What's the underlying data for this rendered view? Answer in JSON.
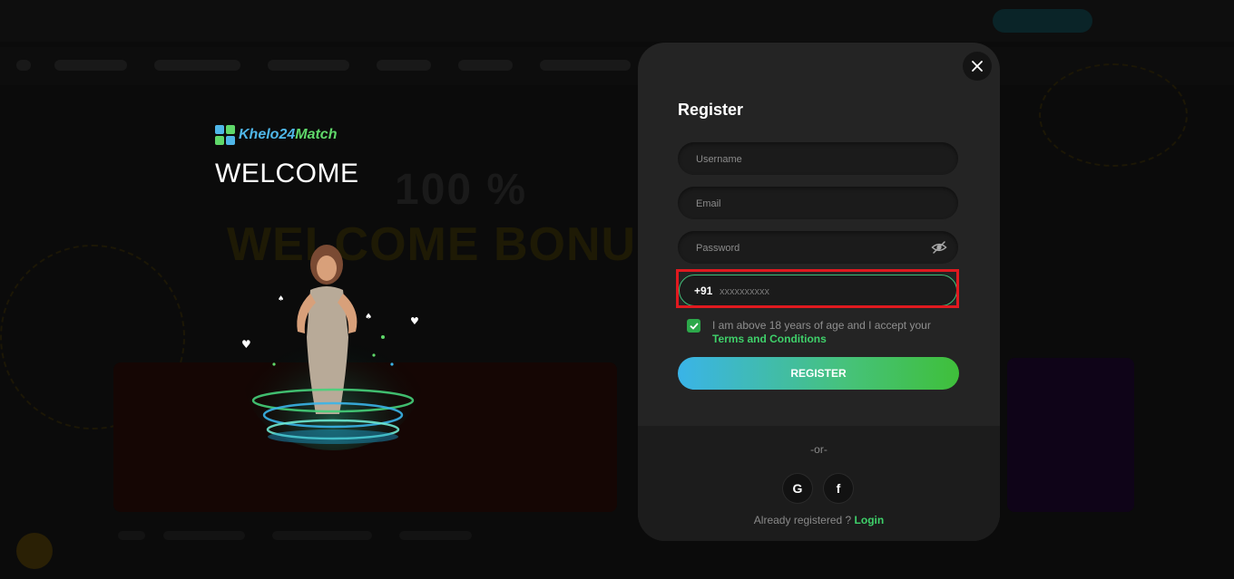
{
  "brand": {
    "logo_text_a": "Khelo24",
    "logo_text_b": "Match",
    "welcome": "WELCOME"
  },
  "background": {
    "banner_line1": "100 %",
    "banner_line2": "WELCOME BONUS"
  },
  "modal": {
    "title": "Register",
    "username_placeholder": "Username",
    "email_placeholder": "Email",
    "password_placeholder": "Password",
    "phone_code": "+91",
    "phone_placeholder": "xxxxxxxxxx",
    "terms_checked": true,
    "terms_text": "I am above 18 years of age and I accept your ",
    "terms_link": "Terms and Conditions",
    "register_label": "REGISTER",
    "or_text": "-or-",
    "google_label": "G",
    "facebook_label": "f",
    "already_text": "Already registered ? ",
    "login_link": "Login"
  },
  "colors": {
    "accent_green": "#3fd06a",
    "accent_blue": "#3ab4e8",
    "highlight_red": "#e0191f",
    "modal_bg": "#242424"
  },
  "icons": [
    "close-icon",
    "eye-off-icon",
    "check-icon",
    "google-icon",
    "facebook-icon"
  ]
}
